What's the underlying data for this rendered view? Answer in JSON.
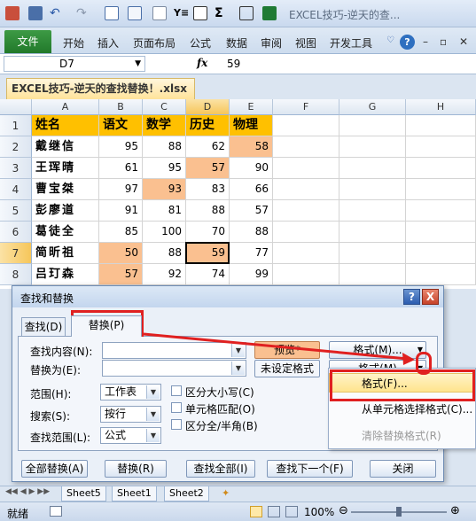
{
  "window": {
    "title": "EXCEL技巧-逆天的查..."
  },
  "ribbon": {
    "file_tab": "文件",
    "tabs": [
      "开始",
      "插入",
      "页面布局",
      "公式",
      "数据",
      "审阅",
      "视图",
      "开发工具"
    ]
  },
  "formula_bar": {
    "name_box": "D7",
    "fx_label": "fx",
    "value": "59"
  },
  "document_tab": {
    "label": "EXCEL技巧-逆天的查找替换！.xlsx"
  },
  "grid": {
    "columns": [
      "A",
      "B",
      "C",
      "D",
      "E",
      "F",
      "G",
      "H"
    ],
    "rows": [
      "1",
      "2",
      "3",
      "4",
      "5",
      "6",
      "7",
      "8"
    ],
    "header": [
      "姓名",
      "语文",
      "数学",
      "历史",
      "物理"
    ],
    "data": [
      [
        "戴继信",
        "95",
        "88",
        "62",
        "58"
      ],
      [
        "王珲晴",
        "61",
        "95",
        "57",
        "90"
      ],
      [
        "曹宝桀",
        "97",
        "93",
        "83",
        "66"
      ],
      [
        "彭廖道",
        "91",
        "81",
        "88",
        "57"
      ],
      [
        "葛徒全",
        "85",
        "100",
        "70",
        "88"
      ],
      [
        "简昕祖",
        "50",
        "88",
        "59",
        "77"
      ],
      [
        "吕玎森",
        "57",
        "92",
        "74",
        "99"
      ]
    ],
    "highlight_color": "#fac090",
    "header_color": "#ffc000"
  },
  "dialog": {
    "title": "查找和替换",
    "tab_find": "查找(D)",
    "tab_replace": "替换(P)",
    "find_what_label": "查找内容(N):",
    "replace_with_label": "替换为(E):",
    "preview_button": "预览*",
    "not_set_format": "未设定格式",
    "format_button_1": "格式(M)...",
    "format_button_2": "格式(M)",
    "within_label": "范围(H):",
    "within_value": "工作表",
    "search_label": "搜索(S):",
    "search_value": "按行",
    "look_in_label": "查找范围(L):",
    "look_in_value": "公式",
    "match_case": "区分大小写(C)",
    "match_cell": "单元格匹配(O)",
    "match_width": "区分全/半角(B)",
    "replace_all": "全部替换(A)",
    "replace": "替换(R)",
    "find_all": "查找全部(I)",
    "find_next": "查找下一个(F)",
    "close": "关闭",
    "help": "?",
    "close_x": "X"
  },
  "format_menu": {
    "items": [
      "格式(F)...",
      "从单元格选择格式(C)...",
      "清除替换格式(R)"
    ]
  },
  "sheet_tabs": [
    "Sheet5",
    "Sheet1",
    "Sheet2"
  ],
  "status": {
    "ready": "就绪",
    "zoom": "100%"
  },
  "annotation_color": "#e02020"
}
